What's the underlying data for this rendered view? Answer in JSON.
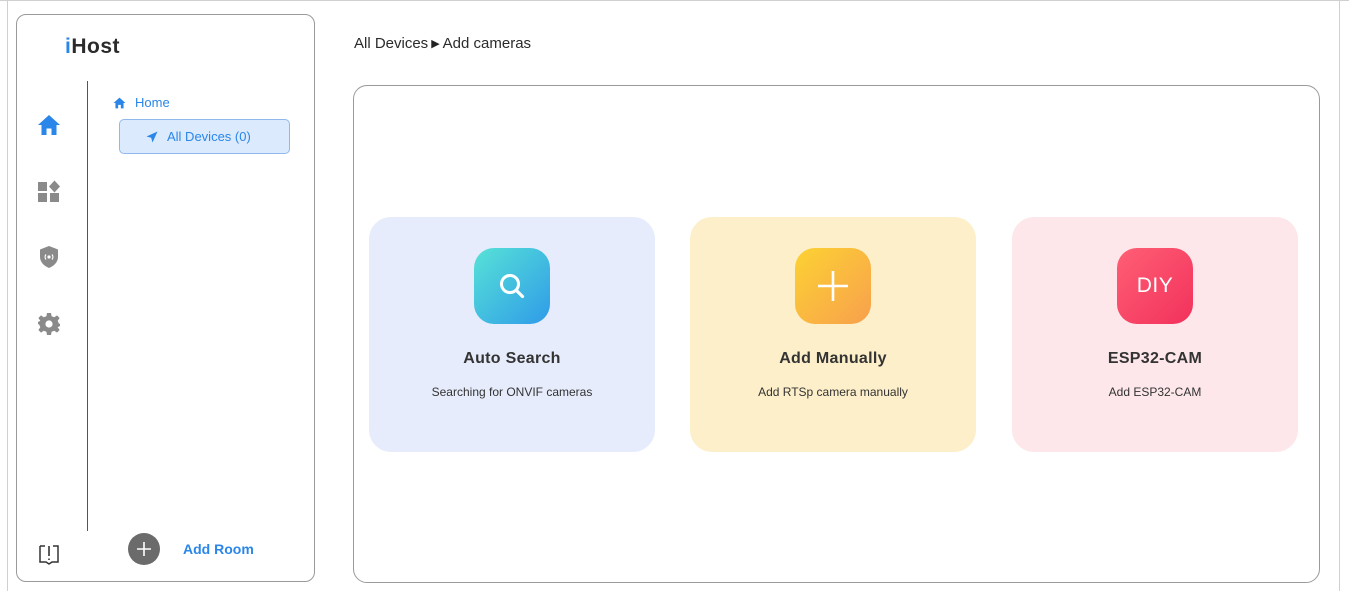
{
  "app": {
    "logo_prefix": "i",
    "logo_rest": "Host"
  },
  "sidebar": {
    "rail": [
      {
        "name": "home-icon",
        "active": true
      },
      {
        "name": "dashboard-icon",
        "active": false
      },
      {
        "name": "security-shield-icon",
        "active": false
      },
      {
        "name": "settings-gear-icon",
        "active": false
      }
    ],
    "tree": {
      "home_label": "Home",
      "devices_label": "All Devices (0)"
    },
    "add_room_label": "Add Room",
    "guide_icon": "book-guide-icon"
  },
  "breadcrumb": {
    "parent": "All Devices",
    "separator": "▶",
    "current": "Add cameras"
  },
  "cards": [
    {
      "icon": "search-icon",
      "title": "Auto Search",
      "subtitle": "Searching for ONVIF cameras"
    },
    {
      "icon": "plus-icon",
      "title": "Add Manually",
      "subtitle": "Add RTSp camera manually"
    },
    {
      "icon_text": "DIY",
      "title": "ESP32-CAM",
      "subtitle": "Add ESP32-CAM"
    }
  ],
  "colors": {
    "accent": "#2a86e8",
    "rail_icon_inactive": "#8a8a8a",
    "card_blue": "#e6ecfb",
    "card_yellow": "#fcefc9",
    "card_pink": "#fde7ea"
  }
}
